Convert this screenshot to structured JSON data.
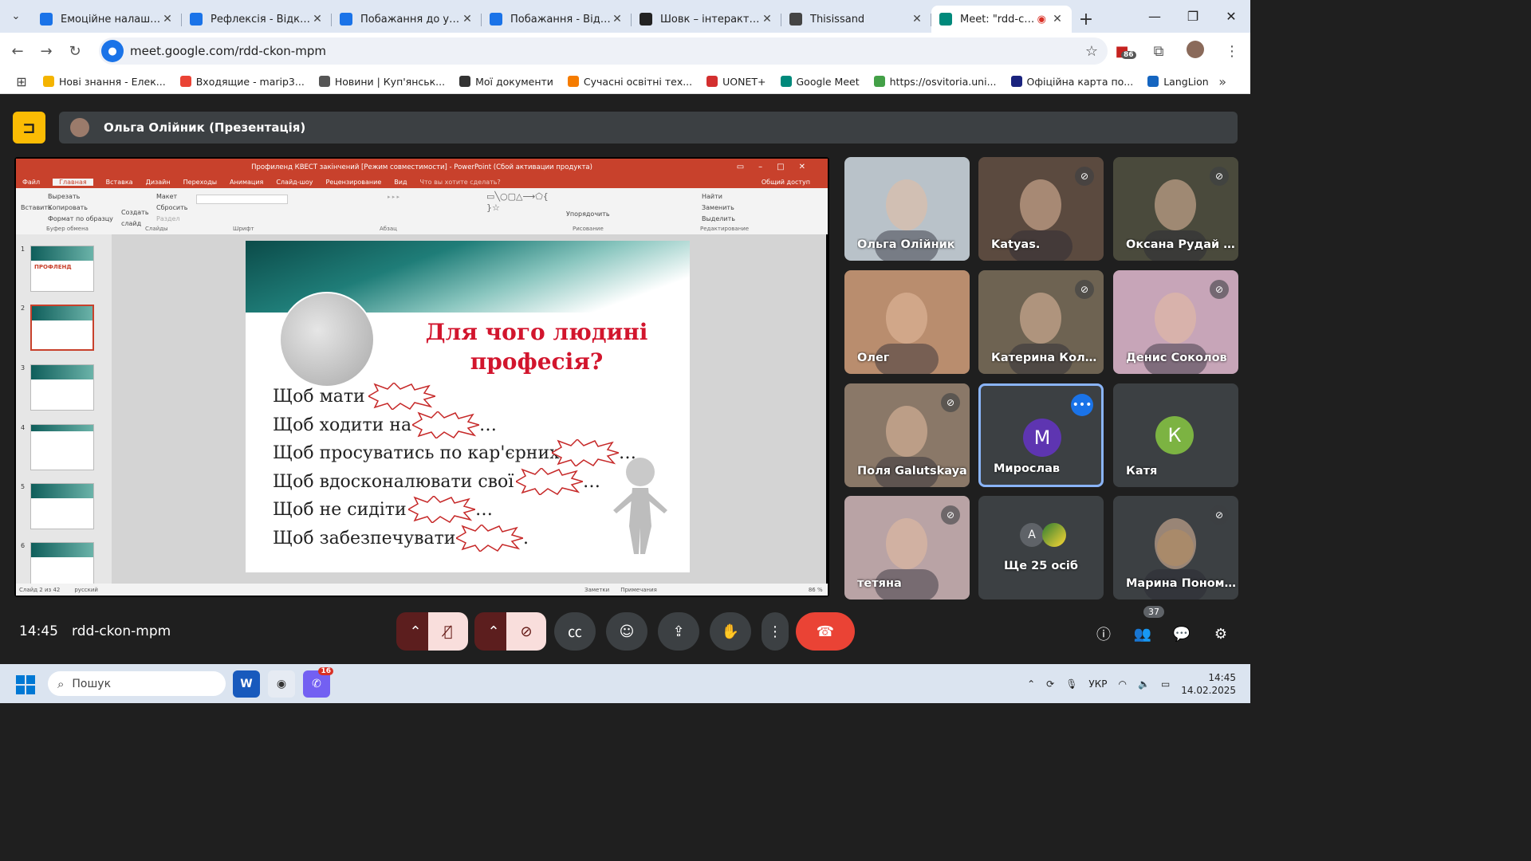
{
  "browser": {
    "tabs": [
      {
        "title": "Емоційне налаштува",
        "color": "#1a73e8",
        "active": false
      },
      {
        "title": "Рефлексія - Відкрий",
        "color": "#1a73e8",
        "active": false
      },
      {
        "title": "Побажання до урок",
        "color": "#1a73e8",
        "active": false
      },
      {
        "title": "Побажання - Відкри",
        "color": "#1a73e8",
        "active": false
      },
      {
        "title": "Шовк – інтерактивн",
        "color": "#222222",
        "active": false
      },
      {
        "title": "Thisissand",
        "color": "#444444",
        "active": false
      },
      {
        "title": "Meet: \"rdd-ckon",
        "color": "#00897b",
        "active": true
      }
    ],
    "url": "meet.google.com/rdd-ckon-mpm",
    "extensions_badge": "86",
    "bookmarks": [
      {
        "label": "Нові знання - Елек...",
        "color": "#f4b400"
      },
      {
        "label": "Входящие - marip3...",
        "color": "#ea4335"
      },
      {
        "label": "Новини | Куп'янськ...",
        "color": "#555555"
      },
      {
        "label": "Мої документи",
        "color": "#333333"
      },
      {
        "label": "Сучасні освітні тех...",
        "color": "#f57c00"
      },
      {
        "label": "UONET+",
        "color": "#d32f2f"
      },
      {
        "label": "Google Meet",
        "color": "#00897b"
      },
      {
        "label": "https://osvitoria.uni...",
        "color": "#43a047"
      },
      {
        "label": "Офіційна карта по...",
        "color": "#1a237e"
      },
      {
        "label": "LangLion",
        "color": "#1565c0"
      }
    ]
  },
  "meet": {
    "presenter_label": "Ольга Олійник (Презентація)",
    "clock": "14:45",
    "meeting_code": "rdd-ckon-mpm",
    "participants_count": "37",
    "participants": [
      {
        "name": "Ольга Олійник",
        "muted": false,
        "bg": "#b9c2c9"
      },
      {
        "name": "Katyas.",
        "muted": true,
        "bg": "#5b4a3f"
      },
      {
        "name": "Оксана Рудай Р...",
        "muted": true,
        "bg": "#4a4a3c"
      },
      {
        "name": "Олег",
        "muted": false,
        "bg": "#b98d6e"
      },
      {
        "name": "Катерина Коло...",
        "muted": true,
        "bg": "#6e6352"
      },
      {
        "name": "Денис Соколов",
        "muted": true,
        "bg": "#c7a5b8"
      },
      {
        "name": "Поля Galutskaya",
        "muted": true,
        "bg": "#8a7868"
      },
      {
        "name": "Мирослав",
        "muted": false,
        "letter": "М",
        "letter_bg": "#5e35b1"
      },
      {
        "name": "Катя",
        "muted": false,
        "letter": "К",
        "letter_bg": "#7cb342"
      },
      {
        "name": "тетяна",
        "muted": true,
        "bg": "#b9a3a5"
      },
      {
        "name": "Ще 25 осіб",
        "muted": false,
        "more_letter": "A"
      },
      {
        "name": "Марина Пономa...",
        "muted": true,
        "bg": "#3c4043"
      }
    ]
  },
  "powerpoint": {
    "title_bar": "Профиленд КВЕСТ закінчений [Режим совместимости] - PowerPoint (Сбой активации продукта)",
    "tabs": [
      "Файл",
      "Главная",
      "Вставка",
      "Дизайн",
      "Переходы",
      "Анимация",
      "Слайд-шоу",
      "Рецензирование",
      "Вид",
      "Что вы хотите сделать?"
    ],
    "share": "Общий доступ",
    "ribbon": {
      "clipboard": [
        "Вырезать",
        "Копировать",
        "Формат по образцу"
      ],
      "paste": "Вставить",
      "new_slide": "Создать слайд",
      "slides": [
        "Макет",
        "Сбросить",
        "Раздел"
      ],
      "editing": [
        "Найти",
        "Заменить",
        "Выделить"
      ],
      "arrange": "Упорядочить",
      "groups": [
        "Буфер обмена",
        "Слайды",
        "Шрифт",
        "Абзац",
        "Рисование",
        "Редактирование"
      ]
    },
    "thumbnails": [
      "1",
      "2",
      "3",
      "4",
      "5",
      "6"
    ],
    "thumb1_title": "ПРОФЛЕНД",
    "slide": {
      "title": "Для чого людині професія?",
      "lines": [
        "Щоб мати ",
        "Щоб ходити на ",
        "Щоб просуватись по кар'єрних",
        "Щоб вдосконалювати свої",
        "Щоб не сидіти",
        "Щоб забезпечувати"
      ],
      "trailers": [
        "",
        "…",
        "…",
        "…",
        "…",
        "."
      ]
    },
    "status": {
      "slide": "Слайд 2 из 42",
      "lang": "русский",
      "notes": "Заметки",
      "comments": "Примечания",
      "zoom": "86 %"
    }
  },
  "taskbar": {
    "search": "Пошук",
    "lang": "УКР",
    "time": "14:45",
    "date": "14.02.2025",
    "viber_badge": "16"
  }
}
